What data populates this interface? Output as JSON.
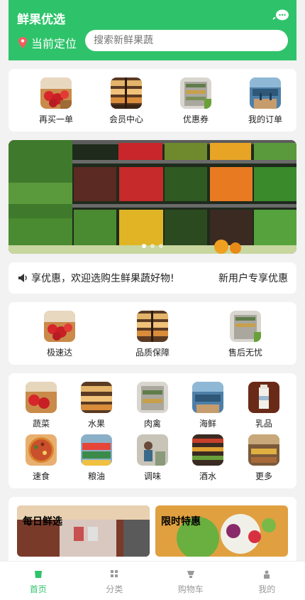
{
  "header": {
    "title": "鲜果优选",
    "location_label": "当前定位",
    "search_placeholder": "搜索新鲜果蔬",
    "accent": "#2ec36a"
  },
  "quick_actions": [
    {
      "label": "再买一单",
      "icon": "strawberry-thumb"
    },
    {
      "label": "会员中心",
      "icon": "store-shelf-thumb"
    },
    {
      "label": "优惠券",
      "icon": "fridge-thumb"
    },
    {
      "label": "我的订单",
      "icon": "cafe-thumb"
    }
  ],
  "banner": {
    "slides": 3,
    "active_index": 0
  },
  "notice": {
    "text": "享优惠，欢迎选购生鲜果蔬好物!",
    "tag": "新用户专享优惠"
  },
  "features": [
    {
      "label": "极速达",
      "icon": "strawberry-thumb"
    },
    {
      "label": "品质保障",
      "icon": "store-shelf-thumb"
    },
    {
      "label": "售后无忧",
      "icon": "fridge-thumb"
    }
  ],
  "categories": [
    {
      "label": "蔬菜",
      "icon": "vegetable-thumb"
    },
    {
      "label": "水果",
      "icon": "fruit-thumb"
    },
    {
      "label": "肉禽",
      "icon": "meat-thumb"
    },
    {
      "label": "海鲜",
      "icon": "seafood-thumb"
    },
    {
      "label": "乳品",
      "icon": "dairy-thumb"
    },
    {
      "label": "速食",
      "icon": "pizza-thumb"
    },
    {
      "label": "粮油",
      "icon": "grain-oil-thumb"
    },
    {
      "label": "调味",
      "icon": "seasoning-thumb"
    },
    {
      "label": "酒水",
      "icon": "drinks-thumb"
    },
    {
      "label": "更多",
      "icon": "more-thumb"
    }
  ],
  "promos": [
    {
      "title": "每日鲜选",
      "icon": "market-photo"
    },
    {
      "title": "限时特惠",
      "icon": "salad-photo"
    }
  ],
  "tabbar": [
    {
      "label": "首页",
      "icon": "home-icon",
      "active": true
    },
    {
      "label": "分类",
      "icon": "grid-icon",
      "active": false
    },
    {
      "label": "购物车",
      "icon": "cart-icon",
      "active": false
    },
    {
      "label": "我的",
      "icon": "user-icon",
      "active": false
    }
  ]
}
